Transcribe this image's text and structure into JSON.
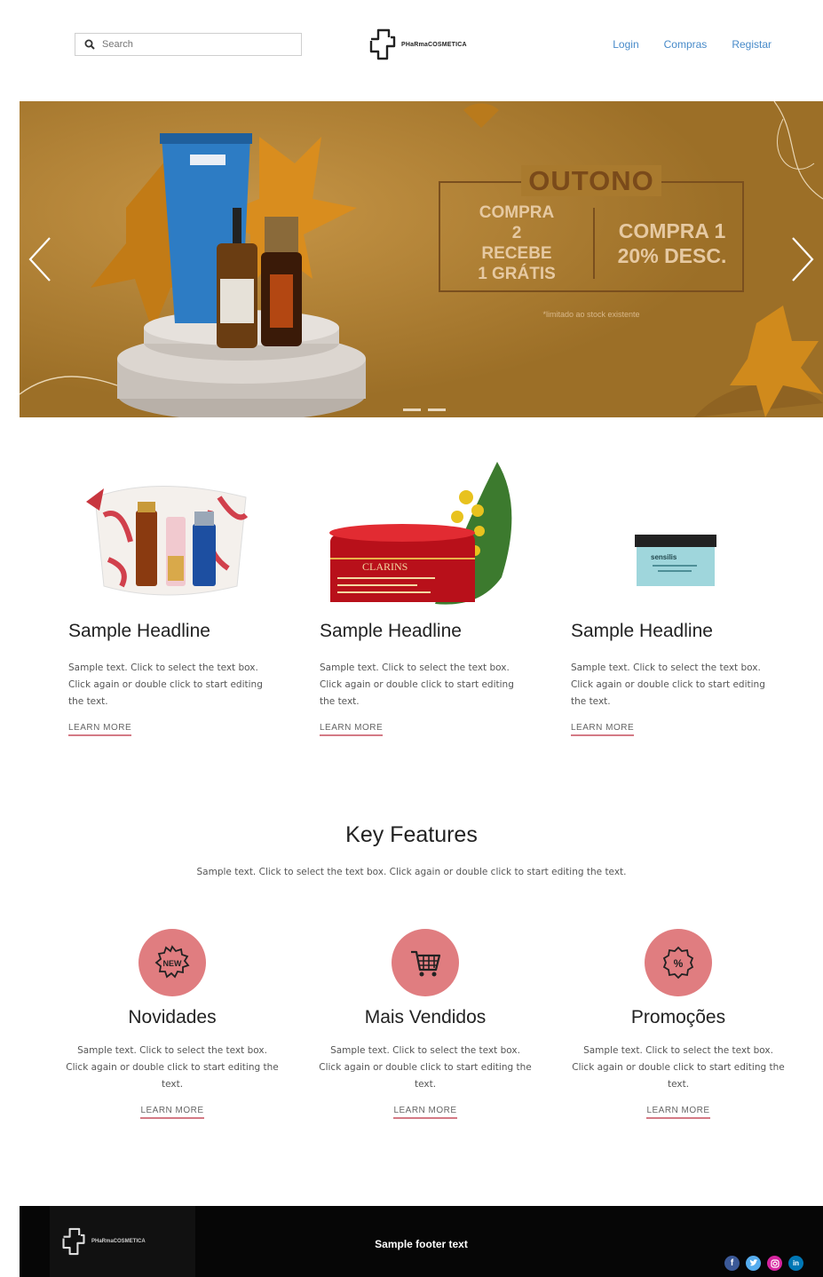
{
  "header": {
    "search_placeholder": "Search",
    "brand": "PHaRmaCOSMETICA",
    "nav": [
      "Login",
      "Compras",
      "Registar"
    ]
  },
  "hero": {
    "promo_title": "OUTONO",
    "promo_left": [
      "COMPRA",
      "2",
      "RECEBE",
      "1 GRÁTIS"
    ],
    "promo_right": [
      "COMPRA 1",
      "20% DESC."
    ],
    "promo_note": "*limitado ao stock existente",
    "colors": {
      "background": "#a97a2e",
      "accent": "#7a4a1a"
    }
  },
  "products": [
    {
      "headline": "Sample Headline",
      "text": "Sample text. Click to select the text box. Click again or double click to start editing the text.",
      "link": "LEARN MORE"
    },
    {
      "headline": "Sample Headline",
      "text": "Sample text. Click to select the text box. Click again or double click to start editing the text.",
      "link": "LEARN MORE",
      "label": "CLARINS"
    },
    {
      "headline": "Sample Headline",
      "text": "Sample text. Click to select the text box. Click again or double click to start editing the text.",
      "link": "LEARN MORE",
      "label": "sensilis"
    }
  ],
  "key_features": {
    "title": "Key Features",
    "subtitle": "Sample text. Click to select the text box. Click again or double click to start editing the text.",
    "items": [
      {
        "icon": "new-badge-icon",
        "title": "Novidades",
        "text": "Sample text. Click to select the text box. Click again or double click to start editing the text.",
        "link": "LEARN MORE"
      },
      {
        "icon": "shopping-cart-icon",
        "title": "Mais Vendidos",
        "text": "Sample text. Click to select the text box. Click again or double click to start editing the text.",
        "link": "LEARN MORE"
      },
      {
        "icon": "percent-badge-icon",
        "title": "Promoções",
        "text": "Sample text. Click to select the text box. Click again or double click to start editing the text.",
        "link": "LEARN MORE"
      }
    ],
    "accent": "#e07d80"
  },
  "footer": {
    "brand": "PHaRmaCOSMETICA",
    "text": "Sample footer text",
    "socials": [
      "facebook-icon",
      "twitter-icon",
      "instagram-icon",
      "linkedin-icon"
    ]
  }
}
